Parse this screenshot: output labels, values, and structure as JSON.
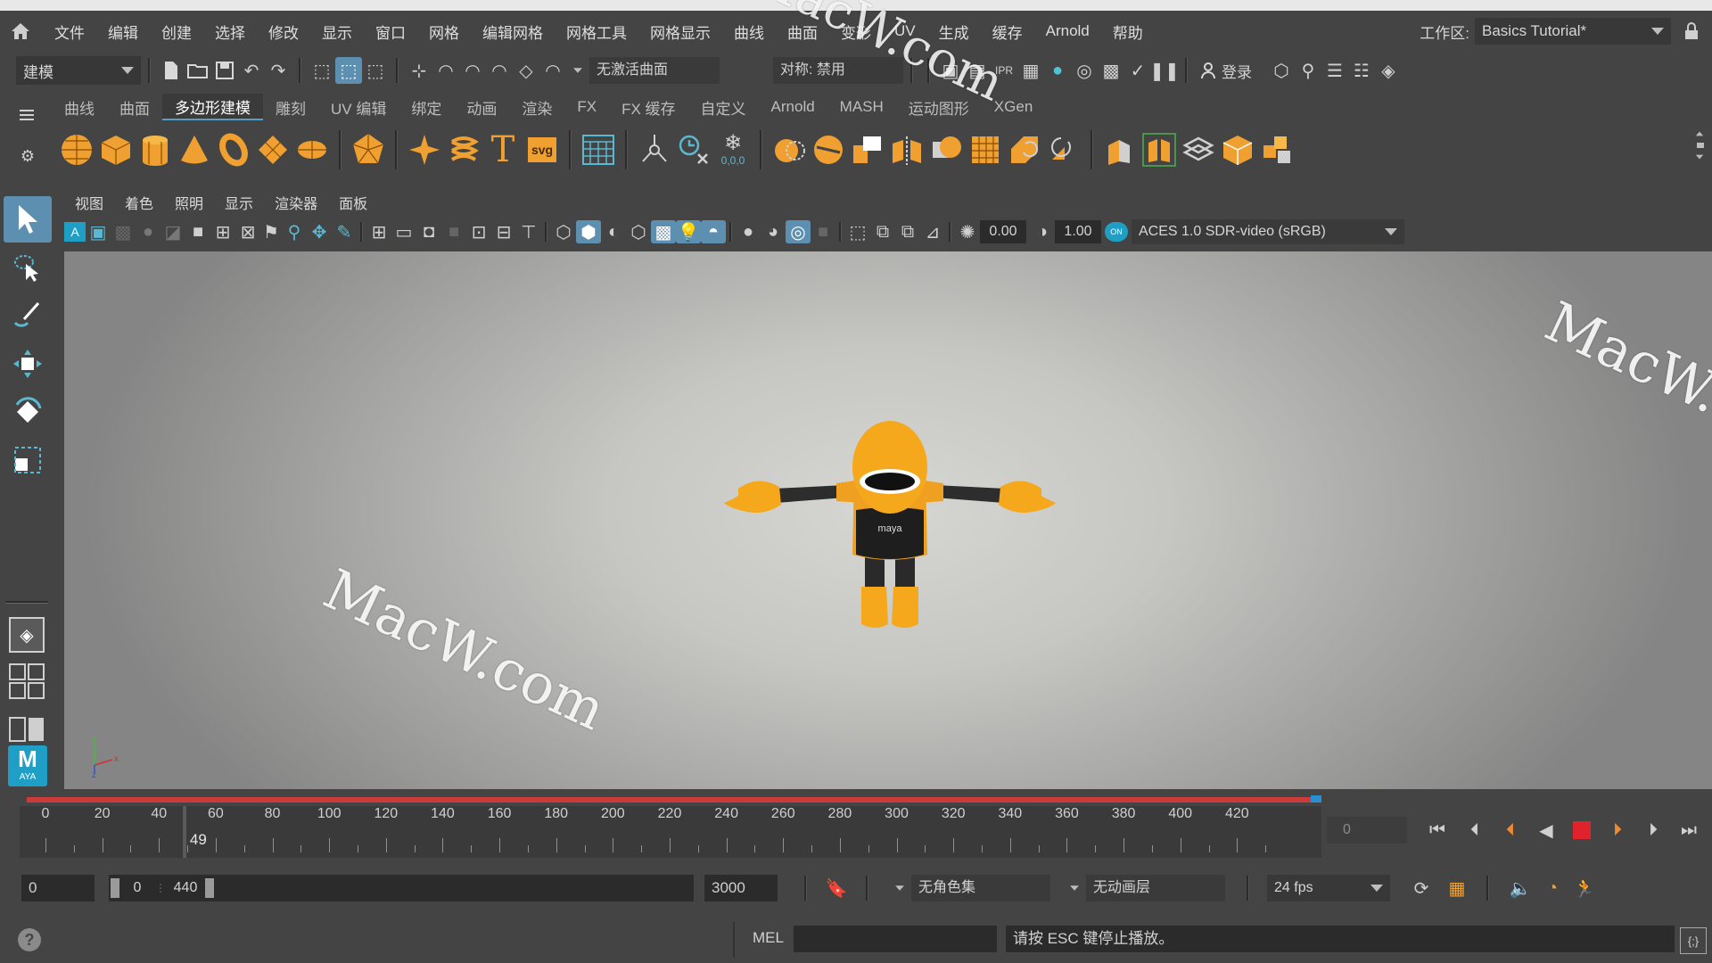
{
  "menubar": {
    "items": [
      "文件",
      "编辑",
      "创建",
      "选择",
      "修改",
      "显示",
      "窗口",
      "网格",
      "编辑网格",
      "网格工具",
      "网格显示",
      "曲线",
      "曲面",
      "变形",
      "UV",
      "生成",
      "缓存",
      "Arnold",
      "帮助"
    ],
    "workspace_label": "工作区:",
    "workspace_value": "Basics Tutorial*"
  },
  "status_line": {
    "mode": "建模",
    "live_surface": "无激活曲面",
    "symmetry": "对称: 禁用",
    "login": "登录"
  },
  "shelf": {
    "tabs": [
      "曲线",
      "曲面",
      "多边形建模",
      "雕刻",
      "UV 编辑",
      "绑定",
      "动画",
      "渲染",
      "FX",
      "FX 缓存",
      "自定义",
      "Arnold",
      "MASH",
      "运动图形",
      "XGen"
    ],
    "active_tab": "多边形建模",
    "text_icon": "T",
    "svg_icon": "svg",
    "coord_label": "0,0,0"
  },
  "viewport": {
    "menu": [
      "视图",
      "着色",
      "照明",
      "显示",
      "渲染器",
      "面板"
    ],
    "exposure": "0.00",
    "gamma": "1.00",
    "color_space": "ACES 1.0 SDR-video (sRGB)",
    "axis_y": "y",
    "axis_x": "x",
    "axis_z": "z",
    "character_chest_text": "maya",
    "watermark": "MacW.com"
  },
  "toolbox": {
    "logo_letter": "M",
    "logo_text": "AYA"
  },
  "timeline": {
    "ticks": [
      0,
      20,
      40,
      60,
      80,
      100,
      120,
      140,
      160,
      180,
      200,
      220,
      240,
      260,
      280,
      300,
      320,
      340,
      360,
      380,
      400,
      420
    ],
    "current_frame": "49",
    "current_frame_value": 49,
    "range_start": 0,
    "range_end": 440,
    "frame_field": "0"
  },
  "range_bar": {
    "start": "0",
    "inner_start": "0",
    "inner_end": "440",
    "end": "3000",
    "character_set": "无角色集",
    "anim_layer": "无动画层",
    "fps": "24 fps"
  },
  "command_line": {
    "lang": "MEL",
    "message": "请按 ESC 键停止播放。"
  },
  "colors": {
    "accent": "#5d8fb0",
    "orange": "#f0a030",
    "stop_red": "#e0232b",
    "time_red": "#cc3a3a"
  }
}
